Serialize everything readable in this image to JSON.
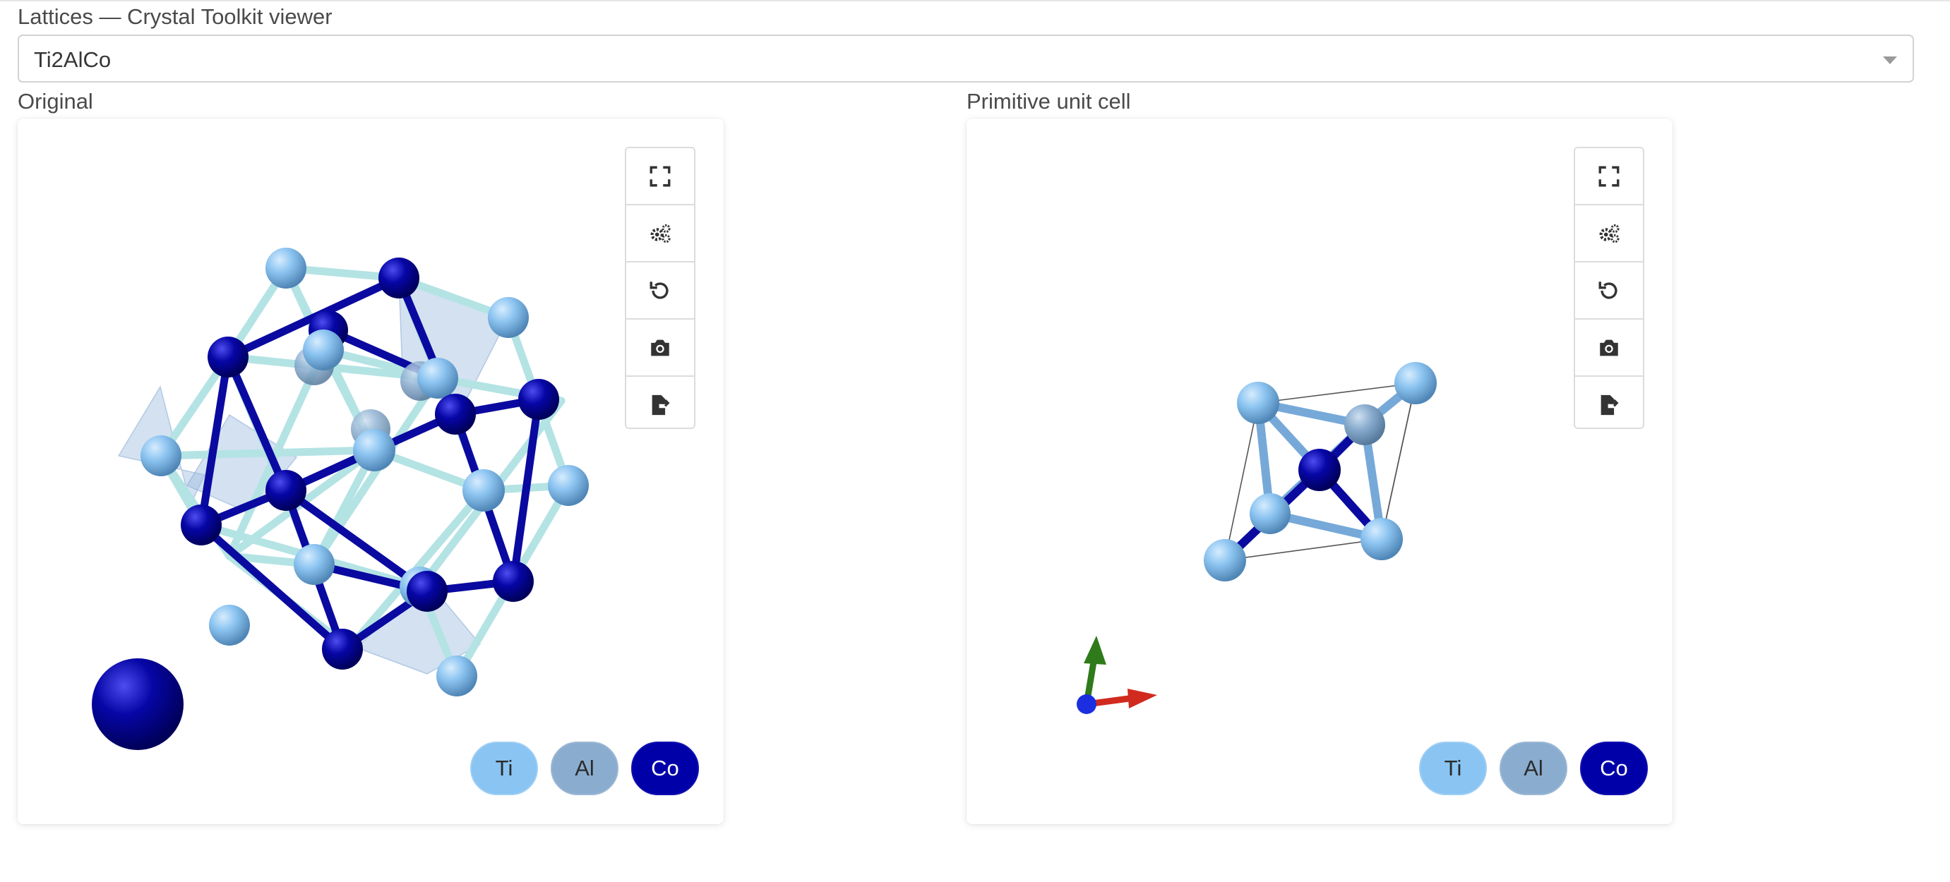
{
  "header": {
    "title": "Lattices — Crystal Toolkit viewer"
  },
  "material_select": {
    "value": "Ti2AlCo"
  },
  "panels": [
    {
      "label": "Original",
      "toolbar": [
        "expand-icon",
        "settings-gears-icon",
        "reset-rotation-icon",
        "camera-icon",
        "export-file-icon"
      ],
      "legend": [
        {
          "symbol": "Ti",
          "color": "#89c4f3"
        },
        {
          "symbol": "Al",
          "color": "#8aadcf"
        },
        {
          "symbol": "Co",
          "color": "#0000a8"
        }
      ]
    },
    {
      "label": "Primitive unit cell",
      "toolbar": [
        "expand-icon",
        "settings-gears-icon",
        "reset-rotation-icon",
        "camera-icon",
        "export-file-icon"
      ],
      "legend": [
        {
          "symbol": "Ti",
          "color": "#89c4f3"
        },
        {
          "symbol": "Al",
          "color": "#8aadcf"
        },
        {
          "symbol": "Co",
          "color": "#0000a8"
        }
      ]
    }
  ],
  "colors": {
    "Ti": "#89c4f3",
    "Al": "#8aadcf",
    "Co": "#0000a8",
    "bond_light": "#b4e3e4",
    "axis_x": "#d12a1e",
    "axis_y": "#2f7a1a",
    "axis_z": "#1b2ee0"
  }
}
